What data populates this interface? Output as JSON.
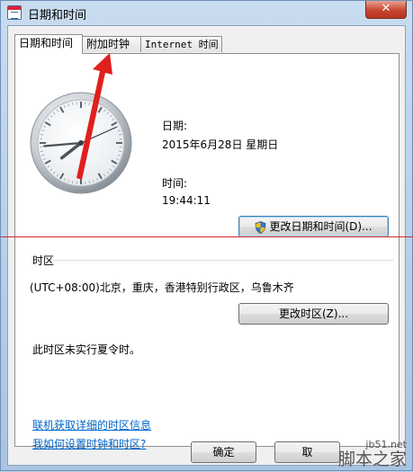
{
  "window": {
    "title": "日期和时间",
    "close_label": "✕"
  },
  "tabs": [
    {
      "label": "日期和时间",
      "active": true
    },
    {
      "label": "附加时钟",
      "active": false
    },
    {
      "label": "Internet 时间",
      "active": false
    }
  ],
  "datetime": {
    "date_label": "日期:",
    "date_value": "2015年6月28日 星期日",
    "time_label": "时间:",
    "time_value": "19:44:11",
    "change_datetime_button": "更改日期和时间(D)..."
  },
  "timezone": {
    "group_label": "时区",
    "value": "(UTC+08:00)北京，重庆，香港特别行政区，乌鲁木齐",
    "change_timezone_button": "更改时区(Z)...",
    "dst_note": "此时区未实行夏令时。"
  },
  "links": {
    "online_info": "联机获取详细的时区信息",
    "how_to_set": "我如何设置时钟和时区?"
  },
  "footer": {
    "ok_button": "确定",
    "cancel_button": "取"
  },
  "watermark": {
    "domain": "jb51.net",
    "name": "脚本之家"
  },
  "colors": {
    "link": "#0066cc",
    "annotation_red": "#e0201e"
  },
  "clock": {
    "hour": 19,
    "minute": 44,
    "second": 11
  }
}
